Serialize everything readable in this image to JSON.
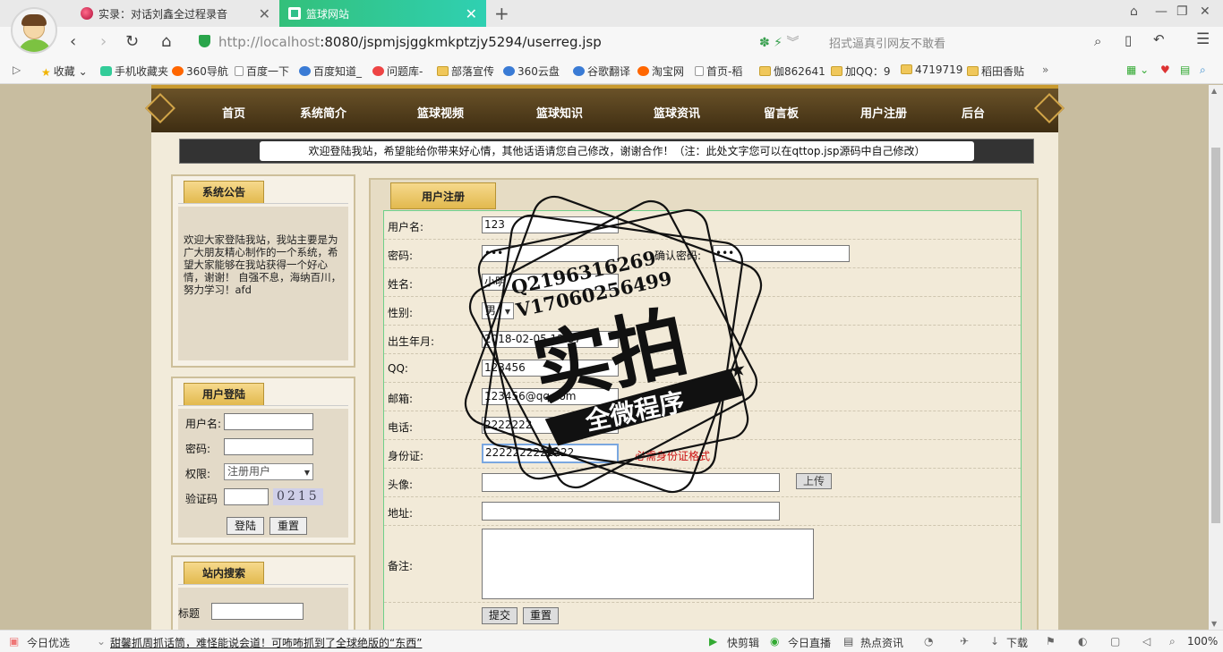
{
  "browser": {
    "tabs": [
      {
        "label": "实录：对话刘鑫全过程录音"
      },
      {
        "label": "篮球网站"
      }
    ],
    "url_host": "http://localhost",
    "url_path": ":8080/jspmjsjggkmkptzjy5294/userreg.jsp",
    "search_placeholder": "招式逼真引网友不敢看",
    "bookmarks": [
      "收藏",
      "手机收藏夹",
      "360导航",
      "百度一下",
      "百度知道_",
      "问题库-",
      "部落宣传",
      "360云盘",
      "谷歌翻译",
      "淘宝网",
      "首页-稻",
      "伽862641",
      "加QQ：9",
      "4719719",
      "稻田香贴"
    ],
    "more": "»"
  },
  "nav": {
    "items": [
      "首页",
      "系统简介",
      "篮球视频",
      "篮球知识",
      "篮球资讯",
      "留言板",
      "用户注册",
      "后台"
    ]
  },
  "marquee": "欢迎登陆我站，希望能给你带来好心情，其他话语请您自己修改，谢谢合作！（注：此处文字您可以在qttop.jsp源码中自己修改）",
  "announcement": {
    "title": "系统公告",
    "text": "欢迎大家登陆我站，我站主要是为广大朋友精心制作的一个系统，希望大家能够在我站获得一个好心情，谢谢！ 自强不息，海纳百川，努力学习！afd"
  },
  "login": {
    "title": "用户登陆",
    "username_label": "用户名:",
    "password_label": "密码:",
    "role_label": "权限:",
    "role_value": "注册用户",
    "captcha_label": "验证码",
    "captcha_value": "0215",
    "login_button": "登陆",
    "reset_button": "重置"
  },
  "site_search": {
    "title": "站内搜索",
    "field_label": "标题"
  },
  "register": {
    "title": "用户注册",
    "username_label": "用户名:",
    "username_value": "123",
    "password_label": "密码:",
    "password_value": "•••",
    "confirm_label": "确认密码:",
    "confirm_value": "•••",
    "name_label": "姓名:",
    "name_value": "小明",
    "gender_label": "性别:",
    "gender_value": "男",
    "birth_label": "出生年月:",
    "birth_value": "2018-02-05 12:37",
    "qq_label": "QQ:",
    "qq_value": "123456",
    "email_label": "邮箱:",
    "email_value": "123456@qq.com",
    "phone_label": "电话:",
    "phone_value": "2222222",
    "id_label": "身份证:",
    "id_value": "2222222222222",
    "id_error": "必需身份证格式",
    "avatar_label": "头像:",
    "upload_button": "上传",
    "address_label": "地址:",
    "remark_label": "备注:",
    "submit_button": "提交",
    "reset_button": "重置"
  },
  "watermark": {
    "line1": "Q2196316269",
    "line2": "V17060256499",
    "big": "实拍",
    "ribbon": "全微程序"
  },
  "statusbar": {
    "left": "今日优选",
    "news": "甜馨抓周抓话筒，难怪能说会道！可咘咘抓到了全球绝版的“东西”",
    "items": [
      "快剪辑",
      "今日直播",
      "热点资讯",
      "下载",
      "100%"
    ]
  },
  "colors": {
    "accent_green": "#2fc08a",
    "nav_brown": "#4e3a18",
    "header_gold": "#e2b94e",
    "error_red": "#cc1111"
  }
}
